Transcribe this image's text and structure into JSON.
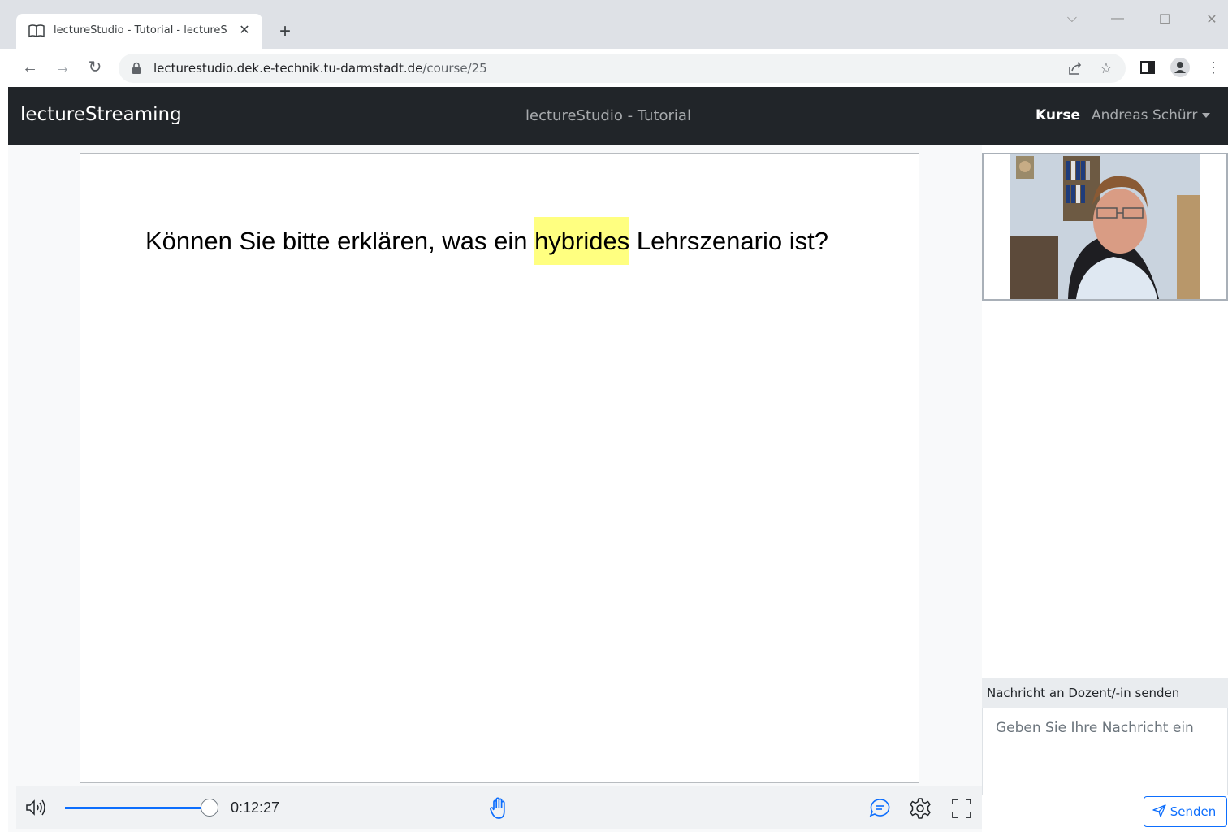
{
  "browser": {
    "tab_title": "lectureStudio - Tutorial - lectureS",
    "tab_close": "✕",
    "new_tab": "+",
    "url_host": "lecturestudio.dek.e-technik.tu-darmstadt.de",
    "url_path": "/course/25",
    "window_controls": {
      "dropdown": "⌵",
      "minimize": "—",
      "maximize": "☐",
      "close": "✕"
    },
    "icons": [
      "back-icon",
      "forward-icon",
      "reload-icon",
      "lock-icon",
      "share-icon",
      "star-icon",
      "sidepanel-icon",
      "profile-icon",
      "menu-icon"
    ]
  },
  "navbar": {
    "brand": "lectureStreaming",
    "title": "lectureStudio - Tutorial",
    "kurse": "Kurse",
    "user": "Andreas Schürr"
  },
  "slide": {
    "text_before": "Können Sie bitte erklären, was ein ",
    "text_highlight": "hybrides",
    "text_after": " Lehrszenario ist?",
    "highlight_color": "#ffff80"
  },
  "player": {
    "time": "0:12:27",
    "accent_color": "#0d6efd",
    "icons": [
      "volume-icon",
      "raise-hand-icon",
      "chat-icon",
      "settings-icon",
      "fullscreen-icon"
    ]
  },
  "chat": {
    "label": "Nachricht an Dozent/-in senden",
    "placeholder": "Geben Sie Ihre Nachricht ein",
    "send_label": "Senden"
  }
}
